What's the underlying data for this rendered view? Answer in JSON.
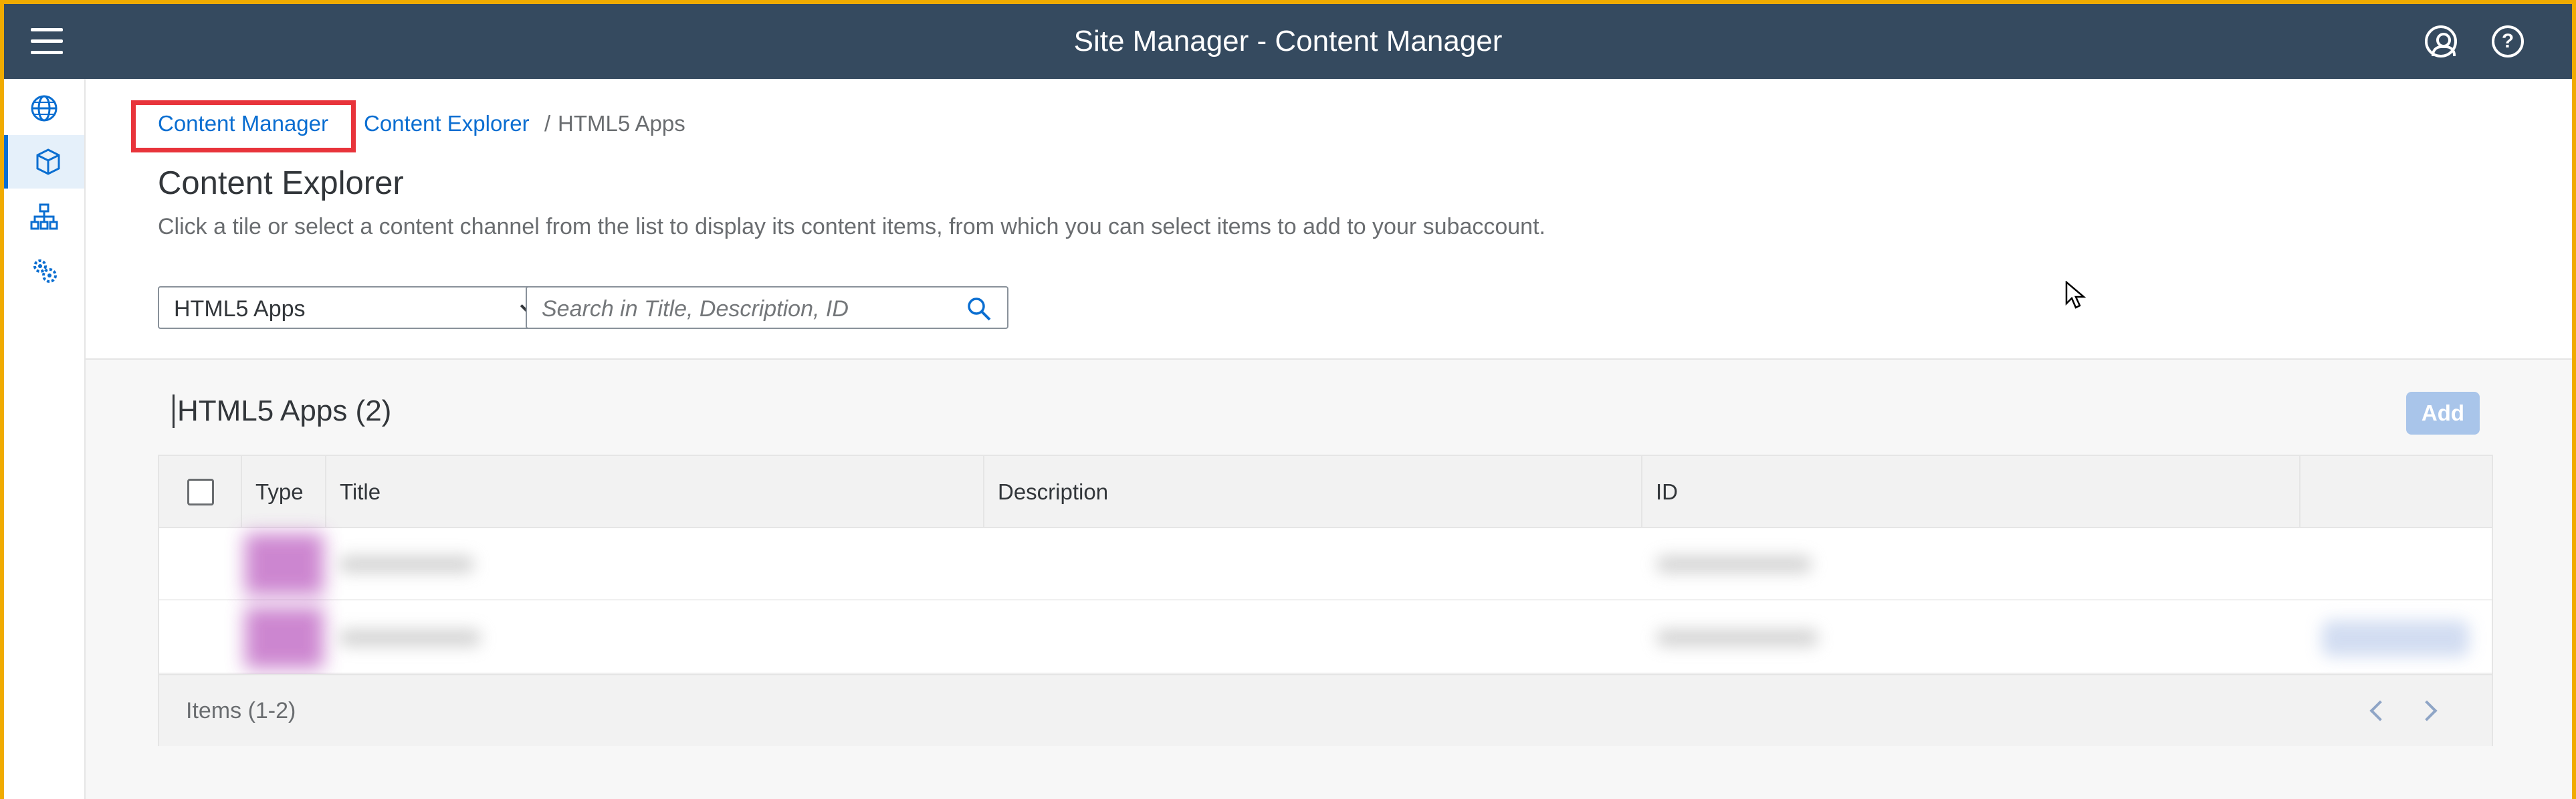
{
  "shell": {
    "title": "Site Manager - Content Manager",
    "icons": [
      "menu-icon",
      "user-icon",
      "help-icon"
    ],
    "help_glyph": "?"
  },
  "sidebar": {
    "items": [
      {
        "icon": "globe-icon",
        "selected": false
      },
      {
        "icon": "cube-icon",
        "selected": true
      },
      {
        "icon": "hierarchy-icon",
        "selected": false
      },
      {
        "icon": "settings-icon",
        "selected": false
      }
    ]
  },
  "breadcrumb": {
    "items": [
      "Content Manager",
      "Content Explorer"
    ],
    "separator": "/",
    "current": "HTML5 Apps"
  },
  "page": {
    "title": "Content Explorer",
    "subtitle": "Click a tile or select a content channel from the list to display its content items, from which you can select items to add to your subaccount."
  },
  "filter": {
    "selected": "HTML5 Apps",
    "search_placeholder": "Search in Title, Description, ID"
  },
  "panel": {
    "title": "HTML5 Apps (2)",
    "add_label": "Add"
  },
  "table": {
    "columns": [
      "Type",
      "Title",
      "Description",
      "ID"
    ],
    "rows": 2,
    "footer": "Items (1-2)"
  },
  "colors": {
    "shell": "#354a5f",
    "accent": "#0a6ed1",
    "highlight": "#e8343b",
    "window_border": "#f0ab00"
  }
}
